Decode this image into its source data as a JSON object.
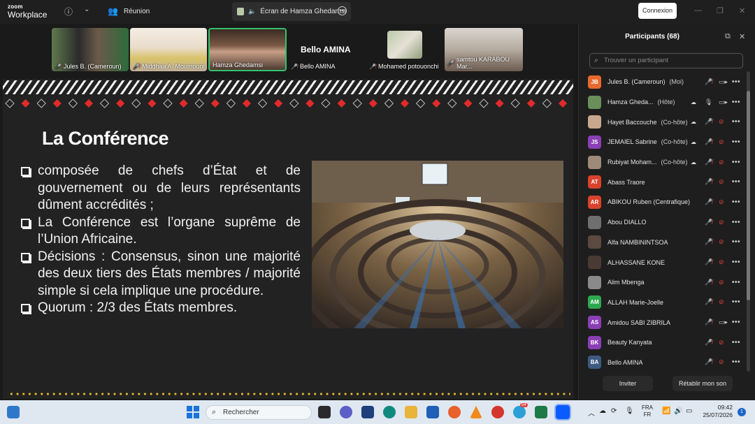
{
  "app": {
    "logo_line1": "zoom",
    "logo_line2": "Workplace",
    "meeting_label": "Réunion",
    "screen_share_label": "Écran de Hamza Ghedamsi",
    "signin_label": "Connexion"
  },
  "video_strip": {
    "tiles": [
      {
        "name": "Jules B. (Cameroun)"
      },
      {
        "name": "Middhaa A. Moumouni"
      },
      {
        "name": "Hamza Ghedamsi",
        "active": true
      },
      {
        "name": "Bello AMINA"
      },
      {
        "name": "Mohamed potouonchi"
      },
      {
        "name": "samtou KARABOU Mar..."
      }
    ],
    "featured_name": "Bello AMINA"
  },
  "slide": {
    "title": "La Conférence",
    "bullets": [
      "composée de chefs d’État et de gouvernement ou de leurs représentants dûment accrédités ;",
      "La Conférence est l’organe suprême de l’Union Africaine.",
      "Décisions : Consensus, sinon une majorité des deux tiers des États membres / majorité simple si cela implique une procédure.",
      "Quorum : 2/3 des États membres."
    ]
  },
  "participants": {
    "title": "Participants (68)",
    "search_placeholder": "Trouver un participant",
    "items": [
      {
        "initials": "JB",
        "color": "#e8692c",
        "name": "Jules B. (Cameroun)",
        "role": "(Moi)",
        "cam_on": true
      },
      {
        "initials": "",
        "color": "#6a8f5a",
        "name": "Hamza Gheda...",
        "role": "(Hôte)",
        "mic_on": true,
        "cam_on": true,
        "cloud": true
      },
      {
        "initials": "",
        "color": "#c9a78c",
        "name": "Hayet Baccouche",
        "role": "(Co-hôte)",
        "cloud": true
      },
      {
        "initials": "JS",
        "color": "#8a3fb5",
        "name": "JEMAIEL Sabrine",
        "role": "(Co-hôte)",
        "cloud": true
      },
      {
        "initials": "",
        "color": "#9d8a78",
        "name": "Rubiyat Moham...",
        "role": "(Co-hôte)",
        "cloud": true
      },
      {
        "initials": "AT",
        "color": "#d9432c",
        "name": "Abass Traore",
        "role": ""
      },
      {
        "initials": "AR",
        "color": "#d9432c",
        "name": "ABIKOU Ruben (Centrafique)",
        "role": ""
      },
      {
        "initials": "",
        "color": "#6f6f6f",
        "name": "Abou DIALLO",
        "role": ""
      },
      {
        "initials": "",
        "color": "#5b4a3f",
        "name": "Alfa NAMBININTSOA",
        "role": ""
      },
      {
        "initials": "",
        "color": "#4a3a35",
        "name": "ALHASSANE KONE",
        "role": ""
      },
      {
        "initials": "",
        "color": "#8a8a8a",
        "name": "Alim Mbenga",
        "role": ""
      },
      {
        "initials": "AM",
        "color": "#2ea84e",
        "name": "ALLAH Marie-Joelle",
        "role": ""
      },
      {
        "initials": "AS",
        "color": "#8a3fb5",
        "name": "Amidou SABI ZIBRILA",
        "role": "",
        "cam_on": true
      },
      {
        "initials": "BK",
        "color": "#8a3fb5",
        "name": "Beauty Kanyata",
        "role": ""
      },
      {
        "initials": "BA",
        "color": "#3d5a80",
        "name": "Bello AMINA",
        "role": ""
      }
    ],
    "invite_label": "Inviter",
    "restore_label": "Rétablir mon son"
  },
  "taskbar": {
    "search_label": "Rechercher",
    "lang_line1": "FRA",
    "lang_line2": "FR",
    "time": "09:42",
    "date": "25/07/2026",
    "notification_count": "1",
    "app_badge": "54"
  }
}
